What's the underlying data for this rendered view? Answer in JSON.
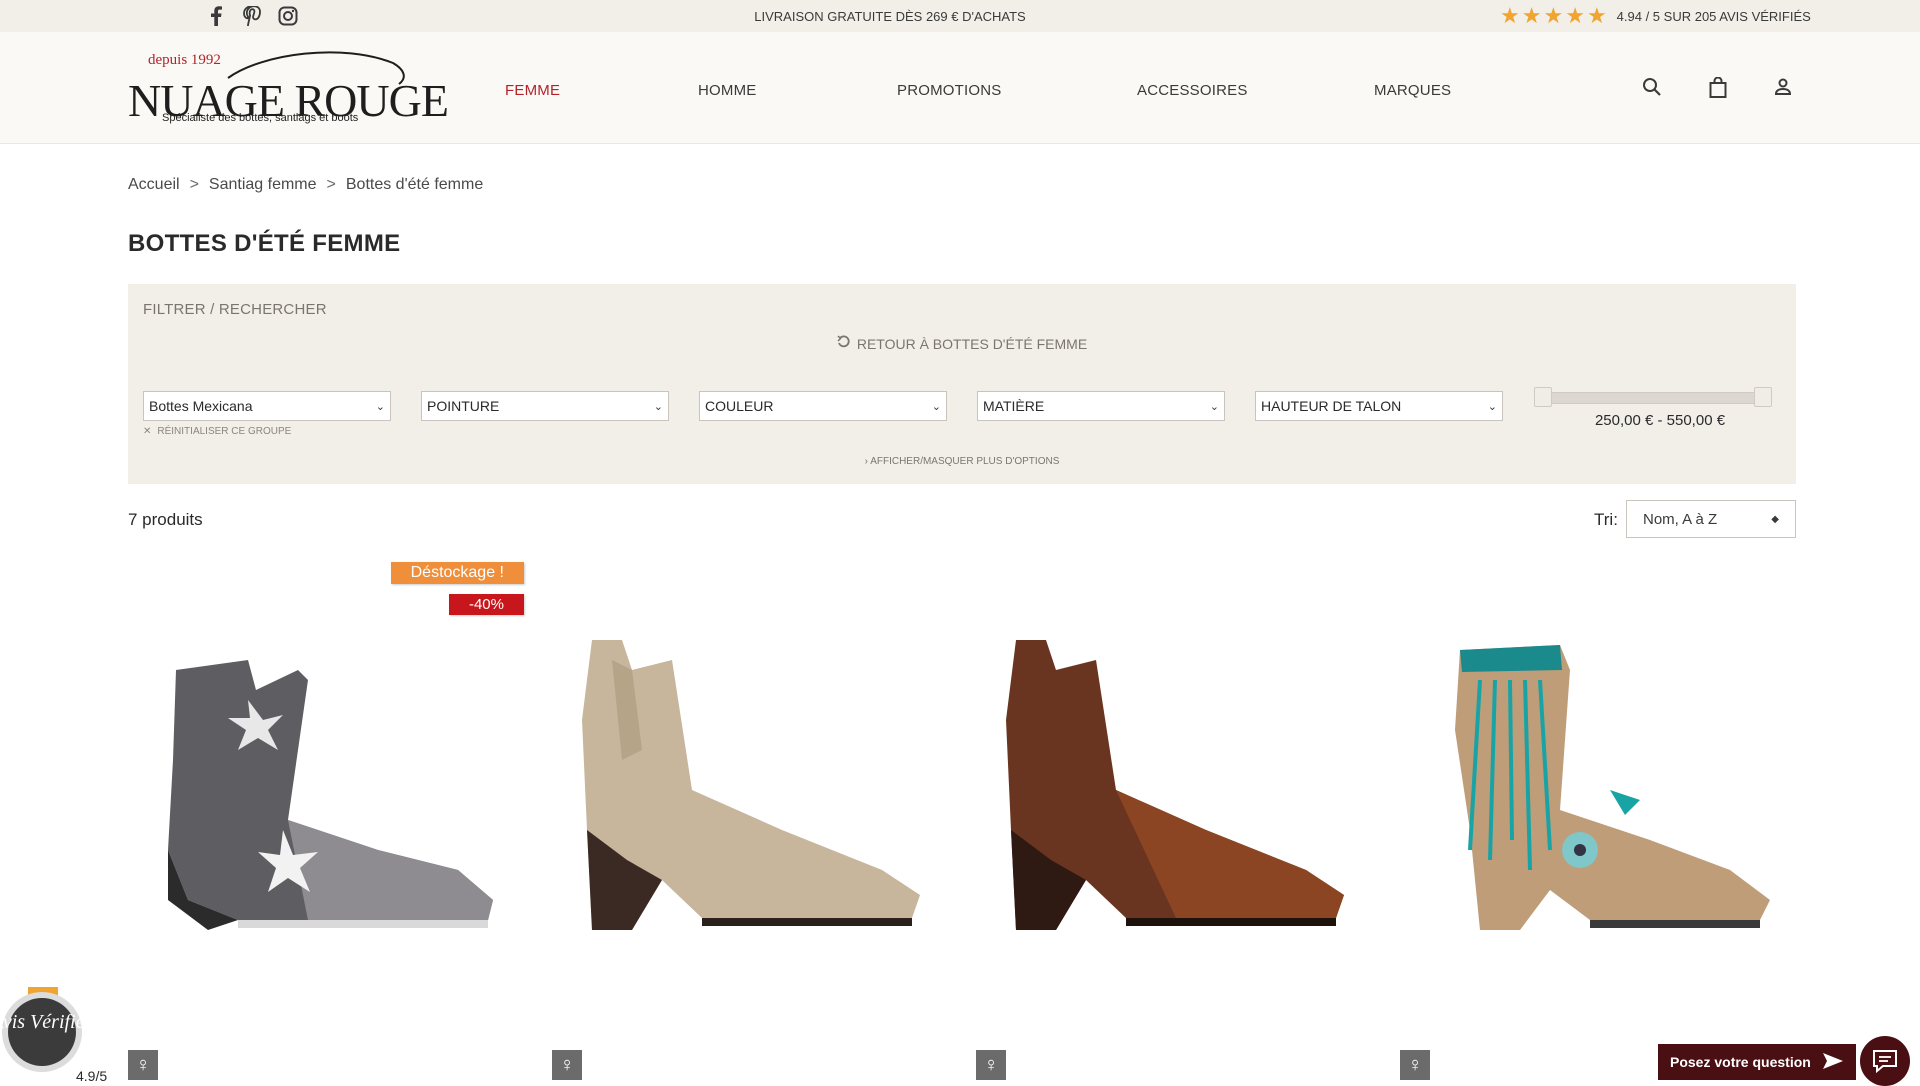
{
  "topbar": {
    "social": [
      {
        "name": "facebook-icon"
      },
      {
        "name": "pinterest-icon"
      },
      {
        "name": "instagram-icon"
      }
    ],
    "promo": "LIVRAISON GRATUITE DÈS 269 € D'ACHATS",
    "rating_text": "4.94 / 5 SUR 205 AVIS VÉRIFIÉS",
    "star_color": "#f0a530"
  },
  "header": {
    "logo_since": "depuis 1992",
    "logo_brand": "NUAGE ROUGE",
    "logo_tagline": "Spécialiste des bottes, santiags et boots",
    "nav": [
      "FEMME",
      "HOMME",
      "PROMOTIONS",
      "ACCESSOIRES",
      "MARQUES"
    ],
    "active_nav": "FEMME",
    "accent": "#b2232a"
  },
  "breadcrumb": [
    "Accueil",
    "Santiag femme",
    "Bottes d'été femme"
  ],
  "breadcrumb_sep": ">",
  "page_title": "BOTTES D'ÉTÉ FEMME",
  "filter": {
    "title": "FILTRER / RECHERCHER",
    "back_link": "RETOUR À BOTTES D'ÉTÉ FEMME",
    "selects": [
      "Bottes Mexicana",
      "POINTURE",
      "COULEUR",
      "MATIÈRE",
      "HAUTEUR DE TALON"
    ],
    "reset_group": "RÉINITIALISER CE GROUPE",
    "price_range": "250,00 € - 550,00 €",
    "more_options": "AFFICHER/MASQUER PLUS D'OPTIONS"
  },
  "results": {
    "count": "7 produits",
    "sort_label": "Tri:",
    "sort_value": "Nom, A à Z"
  },
  "products": [
    {
      "badge_promo": "Déstockage !",
      "badge_discount": "-40%",
      "gender": "♀"
    },
    {
      "gender": "♀"
    },
    {
      "gender": "♀"
    },
    {
      "gender": "♀"
    }
  ],
  "widgets": {
    "avis_title": "Avis Vérifiés",
    "avis_score": "4.9/5",
    "ask_question": "Posez votre question"
  }
}
